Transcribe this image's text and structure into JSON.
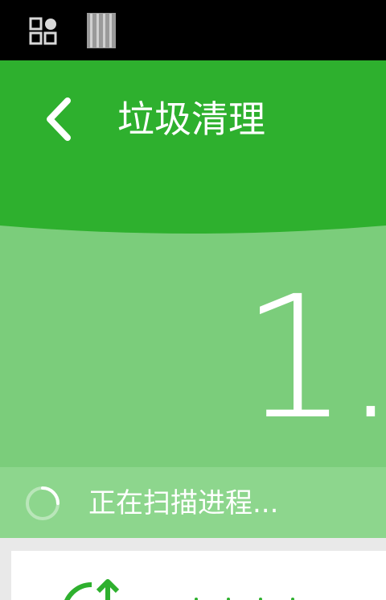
{
  "status_bar": {
    "icons": [
      "apps-grid-icon",
      "battery-icon"
    ]
  },
  "header": {
    "title": "垃圾清理",
    "back_icon": "chevron-left-icon"
  },
  "summary": {
    "size_value": "1."
  },
  "scan": {
    "status_text": "正在扫描进程...",
    "icon": "spinner-icon"
  },
  "card": {
    "icon": "rotate-arrow-icon"
  },
  "colors": {
    "header_green": "#2eb02e",
    "panel_green": "#7bcd7b",
    "scan_green": "#8dd68d",
    "status_black": "#000000"
  }
}
